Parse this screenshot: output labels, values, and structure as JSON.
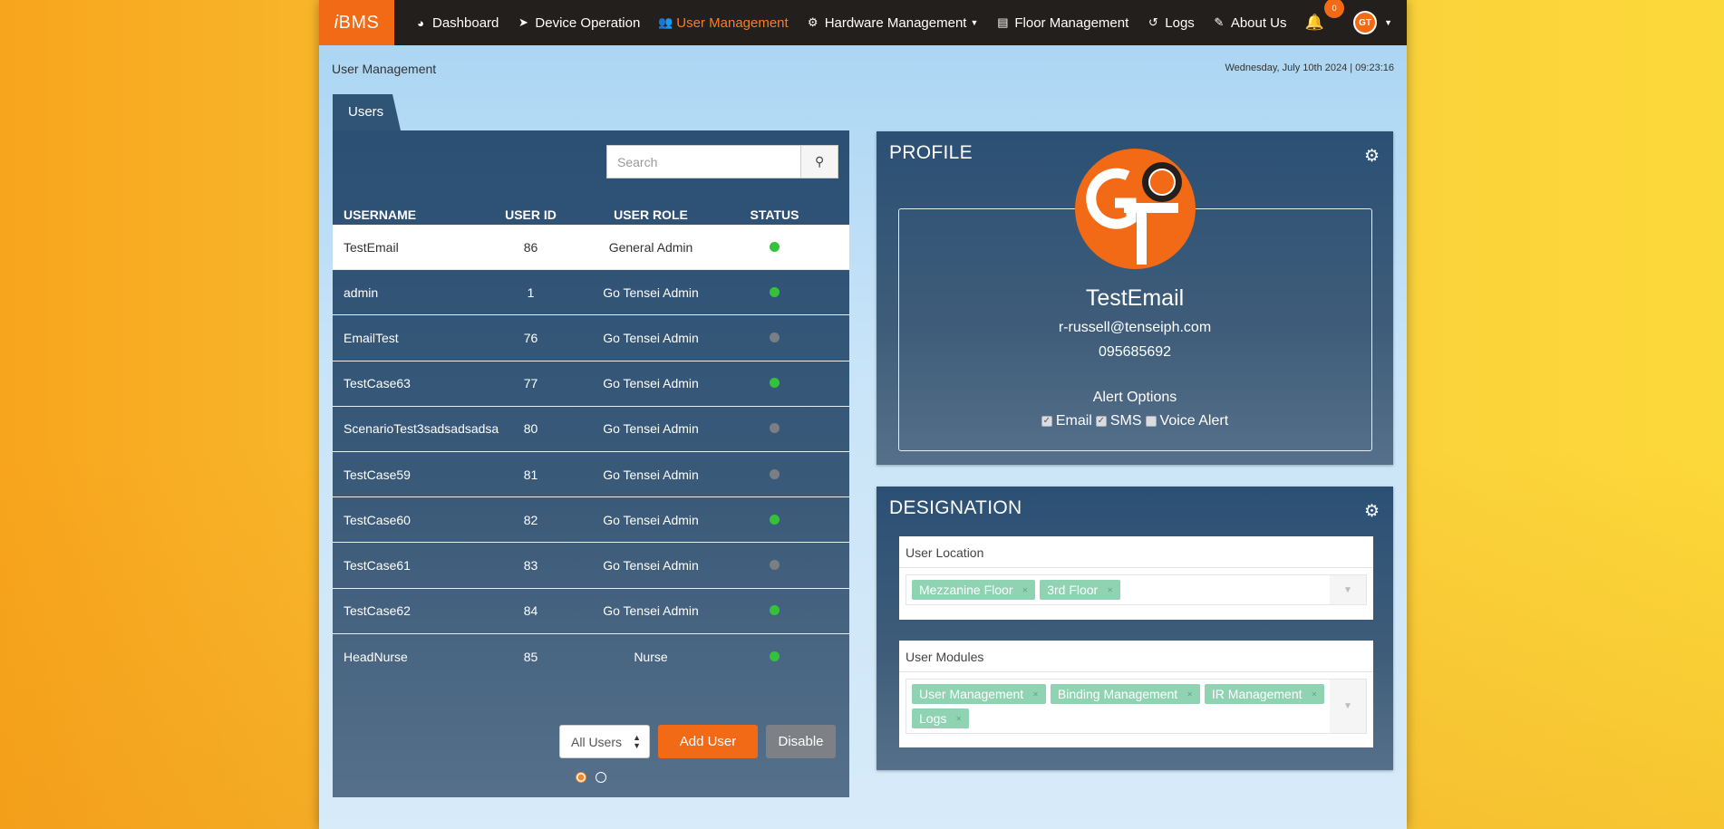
{
  "app": {
    "brand_prefix": "i",
    "brand_suffix": "BMS"
  },
  "nav": {
    "items": [
      {
        "label": "Dashboard",
        "icon": "dashboard-icon"
      },
      {
        "label": "Device Operation",
        "icon": "location-arrow-icon"
      },
      {
        "label": "User Management",
        "icon": "users-icon",
        "active": true
      },
      {
        "label": "Hardware Management",
        "icon": "cogs-icon",
        "dropdown": true
      },
      {
        "label": "Floor Management",
        "icon": "building-icon"
      },
      {
        "label": "Logs",
        "icon": "history-icon"
      },
      {
        "label": "About Us",
        "icon": "edit-icon"
      }
    ],
    "notification_count": "0"
  },
  "breadcrumb": "User Management",
  "datetime": "Wednesday, July 10th 2024  |  09:23:16",
  "users": {
    "tab_label": "Users",
    "search_placeholder": "Search",
    "columns": [
      "USERNAME",
      "USER ID",
      "USER ROLE",
      "STATUS"
    ],
    "rows": [
      {
        "username": "TestEmail",
        "id": "86",
        "role": "General Admin",
        "status": "active",
        "selected": true
      },
      {
        "username": "admin",
        "id": "1",
        "role": "Go Tensei Admin",
        "status": "active"
      },
      {
        "username": "EmailTest",
        "id": "76",
        "role": "Go Tensei Admin",
        "status": "inactive"
      },
      {
        "username": "TestCase63",
        "id": "77",
        "role": "Go Tensei Admin",
        "status": "active"
      },
      {
        "username": "ScenarioTest3sadsadsadsa",
        "id": "80",
        "role": "Go Tensei Admin",
        "status": "inactive"
      },
      {
        "username": "TestCase59",
        "id": "81",
        "role": "Go Tensei Admin",
        "status": "inactive"
      },
      {
        "username": "TestCase60",
        "id": "82",
        "role": "Go Tensei Admin",
        "status": "active"
      },
      {
        "username": "TestCase61",
        "id": "83",
        "role": "Go Tensei Admin",
        "status": "inactive"
      },
      {
        "username": "TestCase62",
        "id": "84",
        "role": "Go Tensei Admin",
        "status": "active"
      },
      {
        "username": "HeadNurse",
        "id": "85",
        "role": "Nurse",
        "status": "active"
      }
    ],
    "filter_value": "All Users",
    "add_label": "Add User",
    "disable_label": "Disable",
    "pages": 2,
    "current_page": 1
  },
  "profile": {
    "title": "PROFILE",
    "name": "TestEmail",
    "email": "r-russell@tenseiph.com",
    "phone": "095685692",
    "alert_title": "Alert Options",
    "alerts": [
      {
        "label": "Email",
        "checked": true
      },
      {
        "label": "SMS",
        "checked": true
      },
      {
        "label": "Voice Alert",
        "checked": false
      }
    ]
  },
  "designation": {
    "title": "DESIGNATION",
    "location_label": "User Location",
    "locations": [
      "Mezzanine Floor",
      "3rd Floor"
    ],
    "modules_label": "User Modules",
    "modules": [
      "User Management",
      "Binding Management",
      "IR Management",
      "Logs"
    ]
  },
  "colors": {
    "accent": "#f26a15",
    "navbar": "#231f1c",
    "panel": "#2f5476",
    "status_on": "#34c23b",
    "status_off": "#7b7f84",
    "tag": "#8fd3b2"
  }
}
